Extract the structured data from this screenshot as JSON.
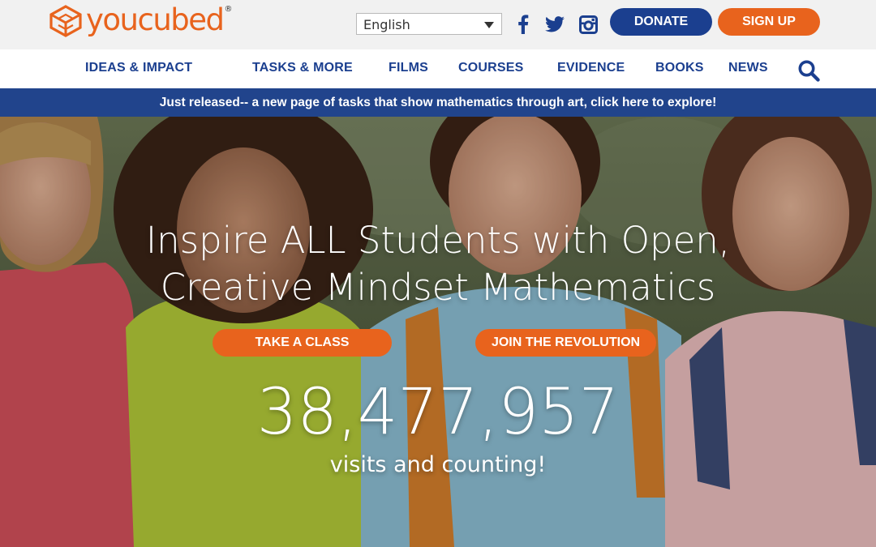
{
  "brand": {
    "name": "youcubed",
    "registered": "®",
    "logo_icon": "cube-logo-icon",
    "color_orange": "#e8631d",
    "color_navy": "#1b3f8f"
  },
  "header": {
    "language": {
      "selected": "English",
      "icon": "chevron-down-icon"
    },
    "social": [
      {
        "name": "facebook",
        "icon": "facebook-icon"
      },
      {
        "name": "twitter",
        "icon": "twitter-icon"
      },
      {
        "name": "instagram",
        "icon": "instagram-icon"
      }
    ],
    "donate_label": "DONATE",
    "signup_label": "SIGN UP"
  },
  "nav": {
    "items": [
      {
        "label": "IDEAS & IMPACT"
      },
      {
        "label": "TASKS & MORE"
      },
      {
        "label": "FILMS"
      },
      {
        "label": "COURSES"
      },
      {
        "label": "EVIDENCE"
      },
      {
        "label": "BOOKS"
      },
      {
        "label": "NEWS"
      }
    ],
    "search_icon": "search-icon"
  },
  "announcement": {
    "text": "Just released-- a new page of tasks that show mathematics through art, click here to explore!",
    "background": "#21448c"
  },
  "hero": {
    "headline_line1": "Inspire ALL Students with Open,",
    "headline_line2": "Creative Mindset Mathematics",
    "cta_primary": "TAKE A CLASS",
    "cta_secondary": "JOIN THE REVOLUTION",
    "visit_count": "38,477,957",
    "visit_caption": "visits and counting!"
  }
}
